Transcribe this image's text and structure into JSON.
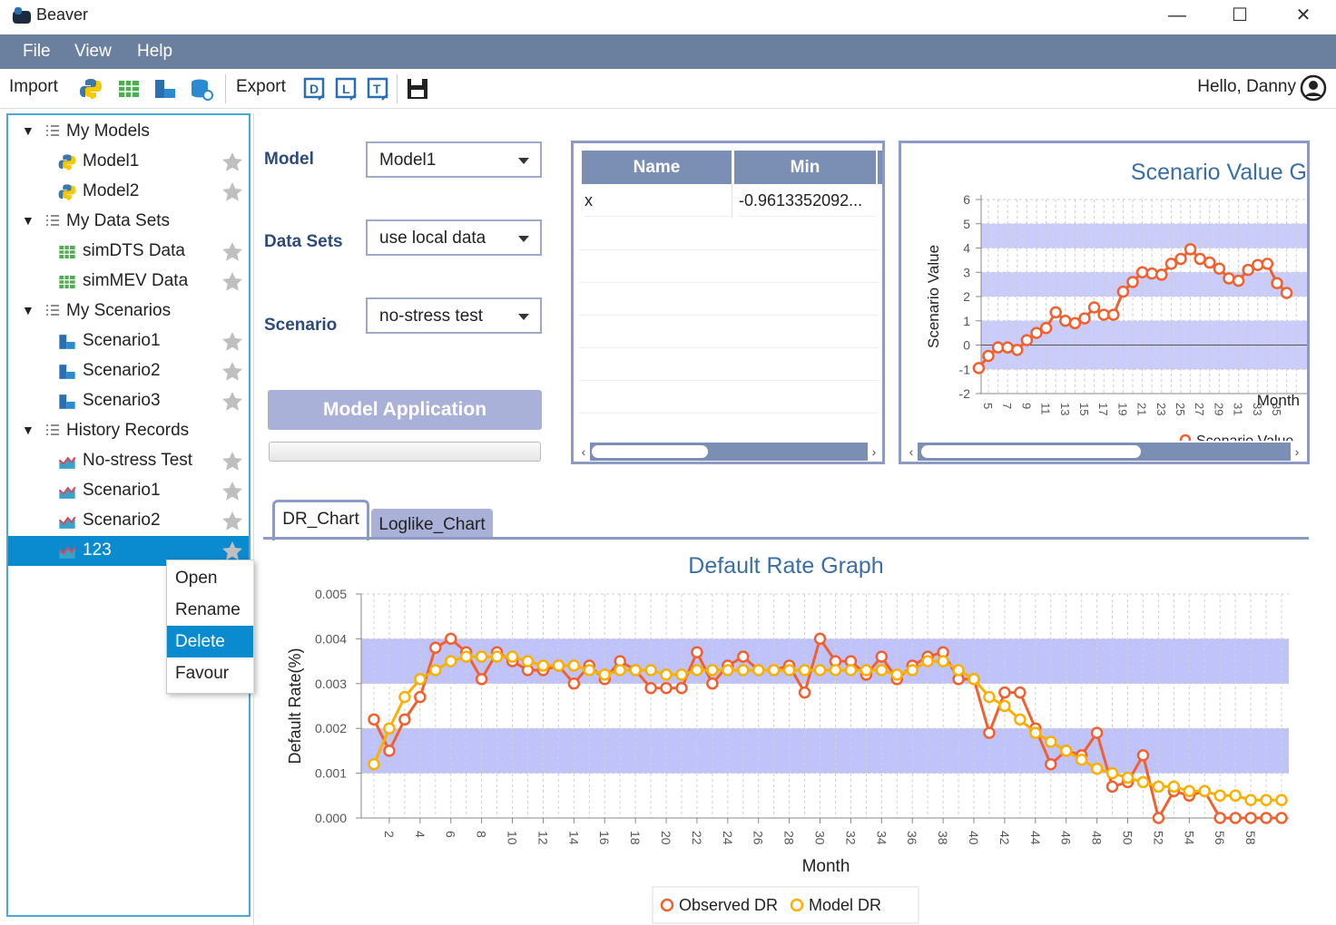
{
  "window": {
    "title": "Beaver"
  },
  "menu": [
    "File",
    "View",
    "Help"
  ],
  "toolbar": {
    "import_label": "Import",
    "export_label": "Export"
  },
  "user": {
    "greeting": "Hello, Danny"
  },
  "sidebar": {
    "groups": [
      {
        "label": "My Models",
        "items": [
          {
            "label": "Model1",
            "icon": "python-icon"
          },
          {
            "label": "Model2",
            "icon": "python-icon"
          }
        ]
      },
      {
        "label": "My Data Sets",
        "items": [
          {
            "label": "simDTS Data",
            "icon": "table-icon"
          },
          {
            "label": "simMEV Data",
            "icon": "table-icon"
          }
        ]
      },
      {
        "label": "My Scenarios",
        "items": [
          {
            "label": "Scenario1",
            "icon": "scenario-icon"
          },
          {
            "label": "Scenario2",
            "icon": "scenario-icon"
          },
          {
            "label": "Scenario3",
            "icon": "scenario-icon"
          }
        ]
      },
      {
        "label": "History Records",
        "items": [
          {
            "label": "No-stress Test",
            "icon": "area-chart-icon"
          },
          {
            "label": "Scenario1",
            "icon": "area-chart-icon"
          },
          {
            "label": "Scenario2",
            "icon": "area-chart-icon"
          },
          {
            "label": "123",
            "icon": "area-chart-icon"
          }
        ]
      }
    ]
  },
  "context_menu": {
    "items": [
      "Open",
      "Rename",
      "Delete",
      "Favour"
    ],
    "highlighted": "Delete"
  },
  "form": {
    "model_label": "Model",
    "model_value": "Model1",
    "datasets_label": "Data Sets",
    "datasets_value": "use local data",
    "scenario_label": "Scenario",
    "scenario_value": "no-stress test",
    "apply_button": "Model Application"
  },
  "param_table": {
    "columns": [
      "Name",
      "Min"
    ],
    "rows": [
      [
        "x",
        "-0.9613352092..."
      ]
    ]
  },
  "tabs": [
    "DR_Chart",
    "Loglike_Chart"
  ],
  "colors": {
    "observed": "#f06030",
    "model": "#f9b000",
    "band": "#b8bcf8",
    "title": "#3a6ea5"
  },
  "chart_data": [
    {
      "type": "line",
      "title": "Scenario Value G",
      "xlabel": "Month",
      "ylabel": "Scenario Value",
      "ylim": [
        -2,
        6
      ],
      "yticks": [
        "-2",
        "-1",
        "0",
        "1",
        "2",
        "3",
        "4",
        "5",
        "6"
      ],
      "x": [
        4,
        5,
        6,
        7,
        8,
        9,
        10,
        11,
        12,
        13,
        14,
        15,
        16,
        17,
        18,
        19,
        20,
        21,
        22,
        23,
        24,
        25,
        26,
        27,
        28,
        29,
        30,
        31,
        32,
        33,
        34,
        35,
        36,
        37
      ],
      "xtick_labels": [
        "5",
        "7",
        "9",
        "11",
        "13",
        "15",
        "17",
        "19",
        "21",
        "23",
        "25",
        "27",
        "29",
        "31",
        "33",
        "35"
      ],
      "series": [
        {
          "name": "Scenario Value",
          "values": [
            -0.95,
            -0.45,
            -0.1,
            -0.1,
            -0.2,
            0.2,
            0.5,
            0.7,
            1.35,
            1.0,
            0.9,
            1.1,
            1.55,
            1.25,
            1.25,
            2.2,
            2.6,
            3.0,
            2.95,
            2.9,
            3.35,
            3.55,
            3.95,
            3.55,
            3.4,
            3.15,
            2.75,
            2.65,
            3.1,
            3.3,
            3.35,
            2.55,
            2.15
          ]
        }
      ],
      "legend": "bottom"
    },
    {
      "type": "line",
      "title": "Default Rate Graph",
      "xlabel": "Month",
      "ylabel": "Default Rate(%)",
      "ylim": [
        0,
        0.005
      ],
      "yticks": [
        "0.000",
        "0.001",
        "0.002",
        "0.003",
        "0.004",
        "0.005"
      ],
      "x": [
        1,
        2,
        3,
        4,
        5,
        6,
        7,
        8,
        9,
        10,
        11,
        12,
        13,
        14,
        15,
        16,
        17,
        18,
        19,
        20,
        21,
        22,
        23,
        24,
        25,
        26,
        27,
        28,
        29,
        30,
        31,
        32,
        33,
        34,
        35,
        36,
        37,
        38,
        39,
        40,
        41,
        42,
        43,
        44,
        45,
        46,
        47,
        48,
        49,
        50,
        51,
        52,
        53,
        54,
        55,
        56,
        57,
        58,
        59,
        60
      ],
      "xtick_labels": [
        "2",
        "4",
        "6",
        "8",
        "10",
        "12",
        "14",
        "16",
        "18",
        "20",
        "22",
        "24",
        "26",
        "28",
        "30",
        "32",
        "34",
        "36",
        "38",
        "40",
        "42",
        "44",
        "46",
        "48",
        "50",
        "52",
        "54",
        "56",
        "58"
      ],
      "legend": "bottom",
      "series": [
        {
          "name": "Observed DR",
          "values": [
            0.0022,
            0.0015,
            0.0022,
            0.0027,
            0.0038,
            0.004,
            0.0037,
            0.0031,
            0.0037,
            0.0035,
            0.0033,
            0.0033,
            0.0034,
            0.003,
            0.0034,
            0.0031,
            0.0035,
            0.0033,
            0.0029,
            0.0029,
            0.0029,
            0.0037,
            0.003,
            0.0034,
            0.0036,
            0.0033,
            0.0033,
            0.0034,
            0.0028,
            0.004,
            0.0035,
            0.0035,
            0.0032,
            0.0036,
            0.0031,
            0.0034,
            0.0036,
            0.0037,
            0.0031,
            0.0031,
            0.0019,
            0.0028,
            0.0028,
            0.002,
            0.0012,
            0.0015,
            0.0014,
            0.0019,
            0.0007,
            0.0008,
            0.0014,
            0.0,
            0.0006,
            0.0005,
            0.0006,
            0.0,
            0.0,
            0.0,
            0.0,
            0.0
          ]
        },
        {
          "name": "Model DR",
          "values": [
            0.0012,
            0.002,
            0.0027,
            0.0031,
            0.0033,
            0.0035,
            0.0036,
            0.0036,
            0.0036,
            0.0036,
            0.0035,
            0.0034,
            0.0034,
            0.0034,
            0.0033,
            0.0032,
            0.0033,
            0.0033,
            0.0033,
            0.0032,
            0.0032,
            0.0033,
            0.0033,
            0.0033,
            0.0033,
            0.0033,
            0.0033,
            0.0033,
            0.0033,
            0.0033,
            0.0033,
            0.0033,
            0.0033,
            0.0033,
            0.0032,
            0.0033,
            0.0035,
            0.0035,
            0.0033,
            0.0031,
            0.0027,
            0.0025,
            0.0022,
            0.0019,
            0.0017,
            0.0015,
            0.0013,
            0.0011,
            0.001,
            0.0009,
            0.0008,
            0.0007,
            0.0007,
            0.0006,
            0.0006,
            0.0005,
            0.0005,
            0.0004,
            0.0004,
            0.0004
          ]
        }
      ]
    }
  ]
}
